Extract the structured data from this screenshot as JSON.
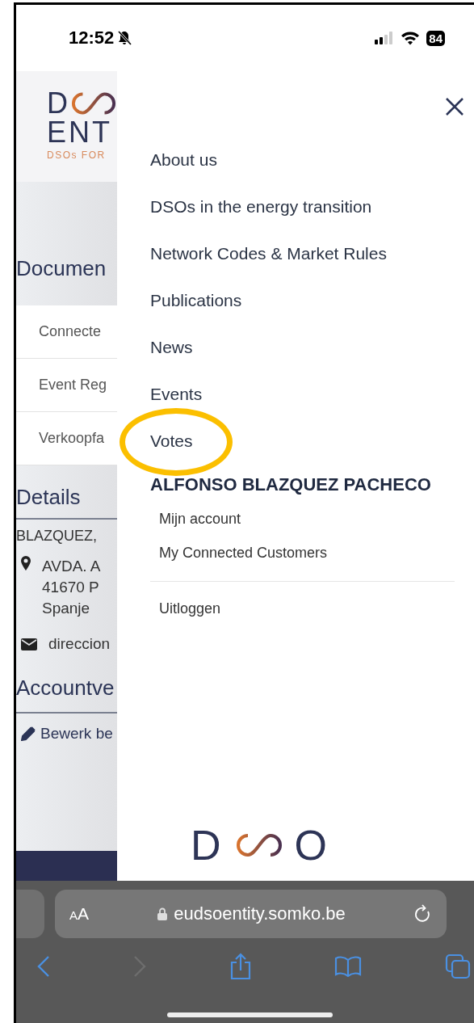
{
  "status_bar": {
    "time": "12:52",
    "battery": "84"
  },
  "page": {
    "logo": {
      "letter": "D",
      "line_2": "ENT",
      "tagline": "DSOs FOR"
    },
    "heading": "Documen",
    "list_items": [
      "Connecte",
      "Event Reg",
      "Verkoopfa"
    ],
    "details_heading": "Details",
    "company": "BLAZQUEZ,",
    "address_lines": [
      "AVDA. A",
      "41670 P",
      "Spanje"
    ],
    "email": "direccion",
    "account_heading": "Accountve",
    "edit_link": "Bewerk be"
  },
  "menu": {
    "items": [
      {
        "label": "About us",
        "highlighted": false
      },
      {
        "label": "DSOs in the energy transition",
        "highlighted": false
      },
      {
        "label": "Network Codes & Market Rules",
        "highlighted": false
      },
      {
        "label": "Publications",
        "highlighted": false
      },
      {
        "label": "News",
        "highlighted": false
      },
      {
        "label": "Events",
        "highlighted": false
      },
      {
        "label": "Votes",
        "highlighted": true
      }
    ],
    "user_name": "ALFONSO BLAZQUEZ PACHECO",
    "account_items": [
      "Mijn account",
      "My Connected Customers"
    ],
    "logout": "Uitloggen",
    "footer_logo": {
      "first": "D",
      "last": "O"
    }
  },
  "browser": {
    "text_size": "AA",
    "url": "eudsoentity.somko.be"
  }
}
